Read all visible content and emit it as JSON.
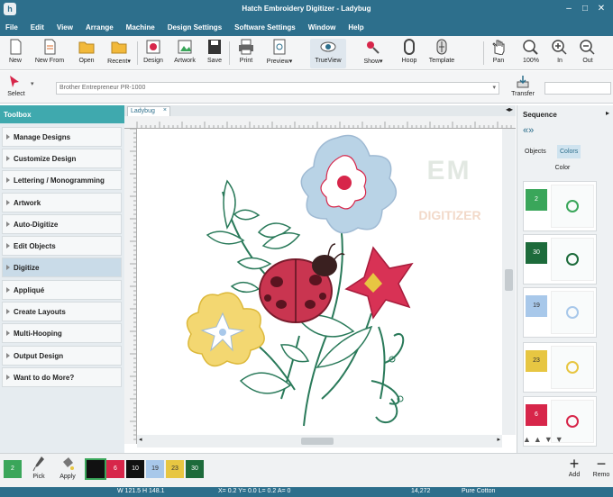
{
  "window": {
    "title": "Hatch Embroidery Digitizer - Ladybug"
  },
  "menu": [
    "File",
    "Edit",
    "View",
    "Arrange",
    "Machine",
    "Design Settings",
    "Software Settings",
    "Window",
    "Help"
  ],
  "toolbar": {
    "new": "New",
    "new_from": "New From",
    "open": "Open",
    "recent": "Recent",
    "design": "Design",
    "artwork": "Artwork",
    "save": "Save",
    "print": "Print",
    "preview": "Preview",
    "trueview": "TrueView",
    "show": "Show",
    "hoop": "Hoop",
    "template": "Template",
    "pan": "Pan",
    "zoom100": "100%",
    "zoom_in": "In",
    "zoom_out": "Out"
  },
  "row2": {
    "select": "Select",
    "machine": "Brother Entrepreneur PR-1000",
    "transfer": "Transfer"
  },
  "toolbox": {
    "title": "Toolbox",
    "items": [
      "Manage Designs",
      "Customize Design",
      "Lettering / Monogramming",
      "Artwork",
      "Auto-Digitize",
      "Edit Objects",
      "Digitize",
      "Appliqué",
      "Create Layouts",
      "Multi-Hooping",
      "Output Design",
      "Want to do More?"
    ]
  },
  "document": {
    "tab": "Ladybug"
  },
  "watermark": {
    "line1": "EM",
    "line2": "DIGITIZER"
  },
  "sequence": {
    "title": "Sequence",
    "tab_objects": "Objects",
    "tab_colors": "Colors",
    "col_header": "Color",
    "rows": [
      {
        "num": "2",
        "color": "#3aa65a"
      },
      {
        "num": "30",
        "color": "#1d6b3b"
      },
      {
        "num": "19",
        "color": "#a8c8ea"
      },
      {
        "num": "23",
        "color": "#e7c642"
      },
      {
        "num": "6",
        "color": "#d7264a"
      }
    ]
  },
  "colorbar": {
    "current": "2",
    "pick": "Pick",
    "apply": "Apply",
    "add": "Add",
    "remove": "Remo",
    "swatches": [
      {
        "num": "",
        "color": "#111"
      },
      {
        "num": "6",
        "color": "#d7264a"
      },
      {
        "num": "10",
        "color": "#111"
      },
      {
        "num": "19",
        "color": "#a8c8ea"
      },
      {
        "num": "23",
        "color": "#e7c642"
      },
      {
        "num": "30",
        "color": "#1d6b3b"
      }
    ]
  },
  "status": {
    "size": "W 121.5 H 148.1",
    "coords": "X= 0.2 Y= 0.0 L= 0.2 A= 0",
    "stitches": "14,272",
    "fabric": "Pure Cotton"
  },
  "colors": {
    "accent": "#2d6f8c",
    "teal": "#3fa9ae"
  }
}
